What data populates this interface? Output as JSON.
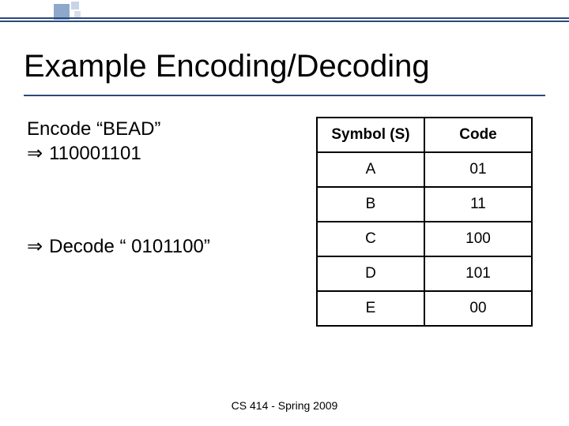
{
  "title": "Example Encoding/Decoding",
  "encode": {
    "label": "Encode “BEAD”",
    "result": "110001101"
  },
  "decode": {
    "label": "Decode “ 0101100”"
  },
  "table": {
    "head_symbol": "Symbol (S)",
    "head_code": "Code",
    "rows": [
      {
        "s": "A",
        "c": "01"
      },
      {
        "s": "B",
        "c": "11"
      },
      {
        "s": "C",
        "c": "100"
      },
      {
        "s": "D",
        "c": "101"
      },
      {
        "s": "E",
        "c": "00"
      }
    ]
  },
  "glyphs": {
    "double_arrow": "⇒"
  },
  "footer": "CS 414 - Spring 2009"
}
